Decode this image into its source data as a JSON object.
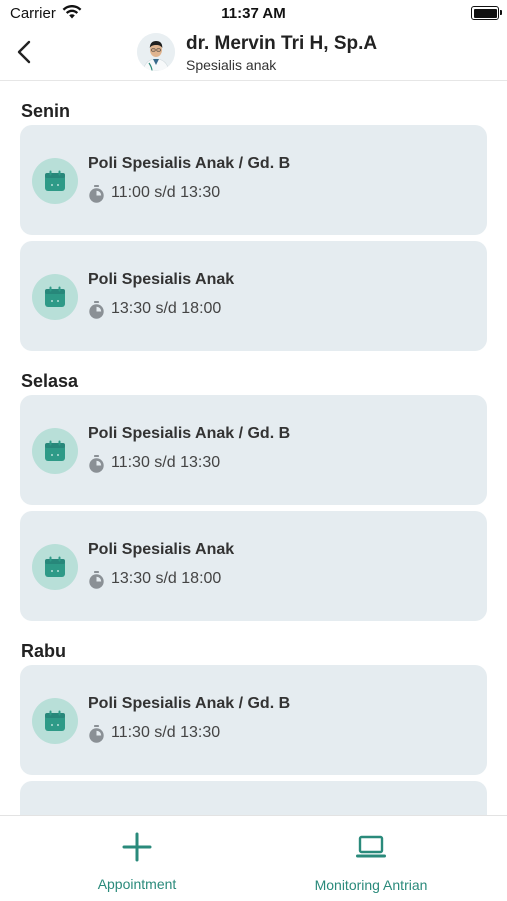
{
  "status_bar": {
    "carrier": "Carrier",
    "time": "11:37 AM"
  },
  "header": {
    "doctor_name": "dr. Mervin Tri H, Sp.A",
    "specialty": "Spesialis anak"
  },
  "schedule": [
    {
      "day": "Senin",
      "slots": [
        {
          "location": "Poli Spesialis Anak / Gd. B",
          "time": "11:00 s/d 13:30"
        },
        {
          "location": "Poli Spesialis Anak",
          "time": "13:30 s/d 18:00"
        }
      ]
    },
    {
      "day": "Selasa",
      "slots": [
        {
          "location": "Poli Spesialis Anak / Gd. B",
          "time": "11:30 s/d 13:30"
        },
        {
          "location": "Poli Spesialis Anak",
          "time": "13:30 s/d 18:00"
        }
      ]
    },
    {
      "day": "Rabu",
      "slots": [
        {
          "location": "Poli Spesialis Anak / Gd. B",
          "time": "11:30 s/d 13:30"
        },
        {
          "location": "",
          "time": ""
        }
      ]
    }
  ],
  "bottom_nav": {
    "appointment_label": "Appointment",
    "monitoring_label": "Monitoring Antrian"
  },
  "colors": {
    "accent": "#2a8a7b",
    "card_bg": "#e5ecf0",
    "icon_circle": "#b8dfd8",
    "calendar_icon": "#2e9a87"
  },
  "icons": {
    "back": "chevron-left-icon",
    "calendar": "calendar-icon",
    "timer": "stopwatch-icon",
    "appointment": "plus-icon",
    "monitoring": "laptop-icon"
  }
}
